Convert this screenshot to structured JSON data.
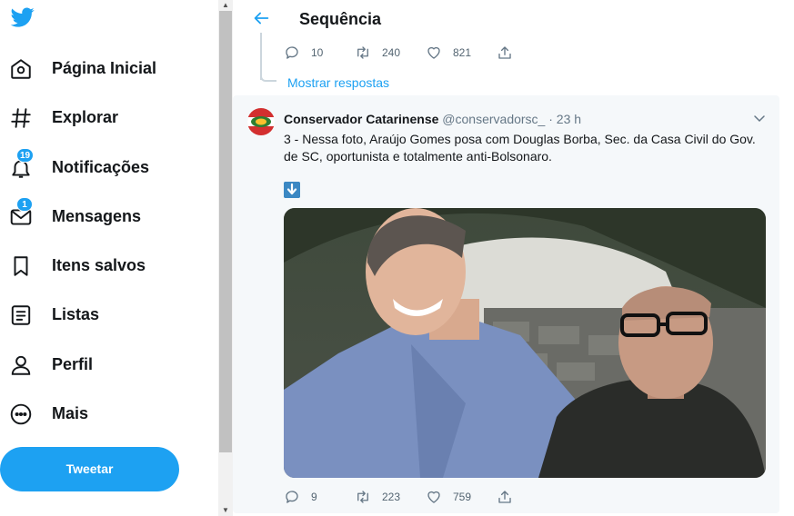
{
  "sidebar": {
    "logo": "twitter-bird-icon",
    "items": [
      {
        "label": "Página Inicial",
        "icon": "home-icon"
      },
      {
        "label": "Explorar",
        "icon": "hashtag-icon"
      },
      {
        "label": "Notificações",
        "icon": "bell-icon",
        "badge": "19"
      },
      {
        "label": "Mensagens",
        "icon": "mail-icon",
        "badge": "1"
      },
      {
        "label": "Itens salvos",
        "icon": "bookmark-icon"
      },
      {
        "label": "Listas",
        "icon": "list-icon"
      },
      {
        "label": "Perfil",
        "icon": "person-icon"
      },
      {
        "label": "Mais",
        "icon": "more-icon"
      }
    ],
    "tweet_button": "Tweetar"
  },
  "header": {
    "title": "Sequência"
  },
  "previous_tweet": {
    "replies": "10",
    "retweets": "240",
    "likes": "821"
  },
  "show_replies": "Mostrar respostas",
  "tweet": {
    "author_name": "Conservador Catarinense",
    "author_handle": "@conservadorsc_",
    "separator": "·",
    "time": "23 h",
    "text": "3 - Nessa foto, Araújo Gomes posa com Douglas Borba, Sec. da Casa Civil do Gov. de SC, oportunista e totalmente anti-Bolsonaro.",
    "emoji": "down-arrow-emoji",
    "replies": "9",
    "retweets": "223",
    "likes": "759"
  },
  "colors": {
    "accent": "#1da1f2",
    "text": "#14171a",
    "muted": "#657786",
    "tweet_bg": "#f5f8fa"
  }
}
